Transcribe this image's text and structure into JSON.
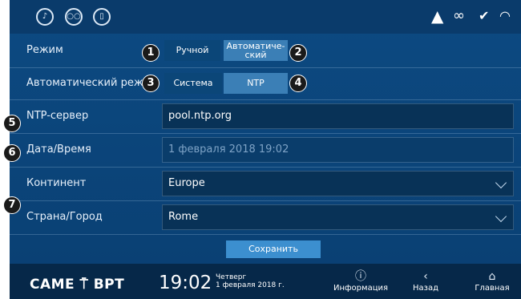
{
  "topbar": {
    "left_icons": [
      "music-off-icon",
      "voicemail-icon",
      "door-icon"
    ],
    "right_icons": [
      "bell-icon",
      "link-icon",
      "check-icon",
      "wifi-icon"
    ]
  },
  "mode": {
    "label": "Режим",
    "options": [
      "Ручной",
      "Автоматиче-\nский"
    ],
    "selected": 1
  },
  "auto_mode": {
    "label": "Автоматический режи",
    "options": [
      "Система",
      "NTP"
    ],
    "selected": 1
  },
  "ntp_server": {
    "label": "NTP-сервер",
    "value": "pool.ntp.org"
  },
  "datetime": {
    "label": "Дата/Время",
    "value": "1 февраля 2018 19:02"
  },
  "continent": {
    "label": "Континент",
    "value": "Europe"
  },
  "city": {
    "label": "Страна/Город",
    "value": "Rome"
  },
  "save_label": "Сохранить",
  "callouts": [
    "1",
    "2",
    "3",
    "4",
    "5",
    "6",
    "7"
  ],
  "bottom": {
    "logo": "CAME ⍑ BPT",
    "time": "19:02",
    "weekday": "Четверг",
    "date": "1 февраля 2018 г.",
    "nav": [
      {
        "label": "Информация",
        "icon": "info-icon"
      },
      {
        "label": "Назад",
        "icon": "back-icon"
      },
      {
        "label": "Главная",
        "icon": "home-icon"
      }
    ]
  },
  "colors": {
    "background": "#0c4a82",
    "accent": "#3c8fcf",
    "topbar": "#0a3b6b"
  }
}
